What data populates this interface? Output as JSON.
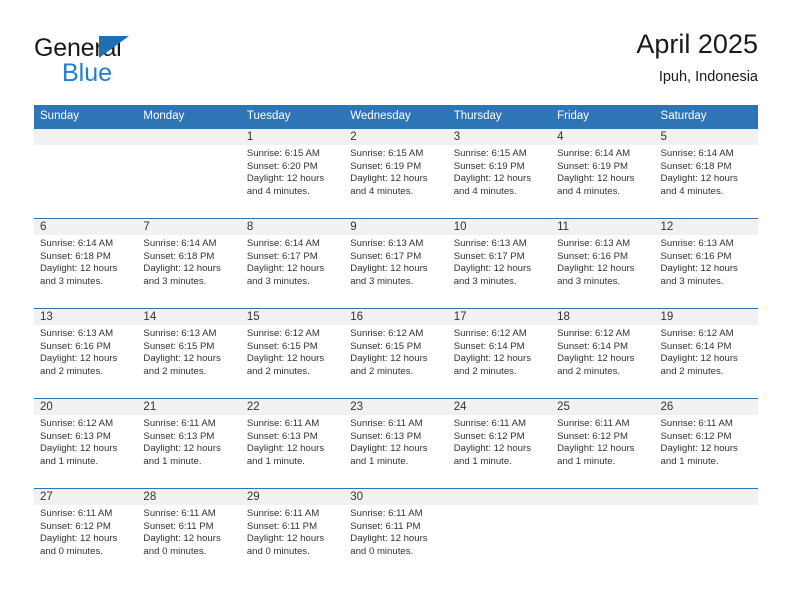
{
  "logo": {
    "word_dark": "General",
    "word_blue": "Blue",
    "triangle_color": "#1f6fb5",
    "blue_color": "#1f7fd0"
  },
  "header": {
    "title": "April 2025",
    "subtitle": "Ipuh, Indonesia"
  },
  "colors": {
    "header_band": "#2e75b6",
    "daynum_strip": "#f1f1f1",
    "row_rule": "#2e75b6",
    "text": "#333333"
  },
  "weekday_headers": [
    "Sunday",
    "Monday",
    "Tuesday",
    "Wednesday",
    "Thursday",
    "Friday",
    "Saturday"
  ],
  "weeks": [
    [
      {
        "day": "",
        "lines": []
      },
      {
        "day": "",
        "lines": []
      },
      {
        "day": "1",
        "lines": [
          "Sunrise: 6:15 AM",
          "Sunset: 6:20 PM",
          "Daylight: 12 hours",
          "and 4 minutes."
        ]
      },
      {
        "day": "2",
        "lines": [
          "Sunrise: 6:15 AM",
          "Sunset: 6:19 PM",
          "Daylight: 12 hours",
          "and 4 minutes."
        ]
      },
      {
        "day": "3",
        "lines": [
          "Sunrise: 6:15 AM",
          "Sunset: 6:19 PM",
          "Daylight: 12 hours",
          "and 4 minutes."
        ]
      },
      {
        "day": "4",
        "lines": [
          "Sunrise: 6:14 AM",
          "Sunset: 6:19 PM",
          "Daylight: 12 hours",
          "and 4 minutes."
        ]
      },
      {
        "day": "5",
        "lines": [
          "Sunrise: 6:14 AM",
          "Sunset: 6:18 PM",
          "Daylight: 12 hours",
          "and 4 minutes."
        ]
      }
    ],
    [
      {
        "day": "6",
        "lines": [
          "Sunrise: 6:14 AM",
          "Sunset: 6:18 PM",
          "Daylight: 12 hours",
          "and 3 minutes."
        ]
      },
      {
        "day": "7",
        "lines": [
          "Sunrise: 6:14 AM",
          "Sunset: 6:18 PM",
          "Daylight: 12 hours",
          "and 3 minutes."
        ]
      },
      {
        "day": "8",
        "lines": [
          "Sunrise: 6:14 AM",
          "Sunset: 6:17 PM",
          "Daylight: 12 hours",
          "and 3 minutes."
        ]
      },
      {
        "day": "9",
        "lines": [
          "Sunrise: 6:13 AM",
          "Sunset: 6:17 PM",
          "Daylight: 12 hours",
          "and 3 minutes."
        ]
      },
      {
        "day": "10",
        "lines": [
          "Sunrise: 6:13 AM",
          "Sunset: 6:17 PM",
          "Daylight: 12 hours",
          "and 3 minutes."
        ]
      },
      {
        "day": "11",
        "lines": [
          "Sunrise: 6:13 AM",
          "Sunset: 6:16 PM",
          "Daylight: 12 hours",
          "and 3 minutes."
        ]
      },
      {
        "day": "12",
        "lines": [
          "Sunrise: 6:13 AM",
          "Sunset: 6:16 PM",
          "Daylight: 12 hours",
          "and 3 minutes."
        ]
      }
    ],
    [
      {
        "day": "13",
        "lines": [
          "Sunrise: 6:13 AM",
          "Sunset: 6:16 PM",
          "Daylight: 12 hours",
          "and 2 minutes."
        ]
      },
      {
        "day": "14",
        "lines": [
          "Sunrise: 6:13 AM",
          "Sunset: 6:15 PM",
          "Daylight: 12 hours",
          "and 2 minutes."
        ]
      },
      {
        "day": "15",
        "lines": [
          "Sunrise: 6:12 AM",
          "Sunset: 6:15 PM",
          "Daylight: 12 hours",
          "and 2 minutes."
        ]
      },
      {
        "day": "16",
        "lines": [
          "Sunrise: 6:12 AM",
          "Sunset: 6:15 PM",
          "Daylight: 12 hours",
          "and 2 minutes."
        ]
      },
      {
        "day": "17",
        "lines": [
          "Sunrise: 6:12 AM",
          "Sunset: 6:14 PM",
          "Daylight: 12 hours",
          "and 2 minutes."
        ]
      },
      {
        "day": "18",
        "lines": [
          "Sunrise: 6:12 AM",
          "Sunset: 6:14 PM",
          "Daylight: 12 hours",
          "and 2 minutes."
        ]
      },
      {
        "day": "19",
        "lines": [
          "Sunrise: 6:12 AM",
          "Sunset: 6:14 PM",
          "Daylight: 12 hours",
          "and 2 minutes."
        ]
      }
    ],
    [
      {
        "day": "20",
        "lines": [
          "Sunrise: 6:12 AM",
          "Sunset: 6:13 PM",
          "Daylight: 12 hours",
          "and 1 minute."
        ]
      },
      {
        "day": "21",
        "lines": [
          "Sunrise: 6:11 AM",
          "Sunset: 6:13 PM",
          "Daylight: 12 hours",
          "and 1 minute."
        ]
      },
      {
        "day": "22",
        "lines": [
          "Sunrise: 6:11 AM",
          "Sunset: 6:13 PM",
          "Daylight: 12 hours",
          "and 1 minute."
        ]
      },
      {
        "day": "23",
        "lines": [
          "Sunrise: 6:11 AM",
          "Sunset: 6:13 PM",
          "Daylight: 12 hours",
          "and 1 minute."
        ]
      },
      {
        "day": "24",
        "lines": [
          "Sunrise: 6:11 AM",
          "Sunset: 6:12 PM",
          "Daylight: 12 hours",
          "and 1 minute."
        ]
      },
      {
        "day": "25",
        "lines": [
          "Sunrise: 6:11 AM",
          "Sunset: 6:12 PM",
          "Daylight: 12 hours",
          "and 1 minute."
        ]
      },
      {
        "day": "26",
        "lines": [
          "Sunrise: 6:11 AM",
          "Sunset: 6:12 PM",
          "Daylight: 12 hours",
          "and 1 minute."
        ]
      }
    ],
    [
      {
        "day": "27",
        "lines": [
          "Sunrise: 6:11 AM",
          "Sunset: 6:12 PM",
          "Daylight: 12 hours",
          "and 0 minutes."
        ]
      },
      {
        "day": "28",
        "lines": [
          "Sunrise: 6:11 AM",
          "Sunset: 6:11 PM",
          "Daylight: 12 hours",
          "and 0 minutes."
        ]
      },
      {
        "day": "29",
        "lines": [
          "Sunrise: 6:11 AM",
          "Sunset: 6:11 PM",
          "Daylight: 12 hours",
          "and 0 minutes."
        ]
      },
      {
        "day": "30",
        "lines": [
          "Sunrise: 6:11 AM",
          "Sunset: 6:11 PM",
          "Daylight: 12 hours",
          "and 0 minutes."
        ]
      },
      {
        "day": "",
        "lines": []
      },
      {
        "day": "",
        "lines": []
      },
      {
        "day": "",
        "lines": []
      }
    ]
  ]
}
